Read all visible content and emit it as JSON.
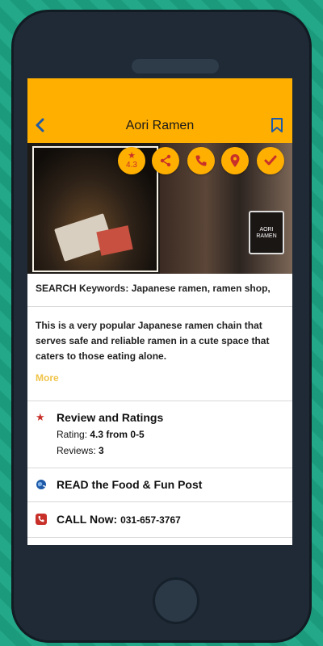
{
  "app": {
    "title": "Aori Ramen"
  },
  "hero": {
    "rating": "4.3",
    "sign_text": "AORI RAMEN",
    "actions": [
      "rating-icon",
      "share-icon",
      "phone-icon",
      "location-pin-icon",
      "check-icon"
    ]
  },
  "keywords": {
    "text": "SEARCH Keywords: Japanese ramen, ramen shop,"
  },
  "description": {
    "text": "This is a very popular Japanese ramen chain that serves safe and reliable ramen in a cute space that caters to those eating alone.",
    "more_label": "More"
  },
  "reviews": {
    "title": "Review and Ratings",
    "rating_label": "Rating:",
    "rating_value": "4.3 from 0-5",
    "reviews_label": "Reviews:",
    "reviews_value": "3"
  },
  "food_post": {
    "label": "READ the Food & Fun Post"
  },
  "call": {
    "label": "CALL Now:",
    "number": "031-657-3767"
  },
  "colors": {
    "header": "#ffaf00",
    "accent_red": "#c8302a",
    "link_blue": "#1e5aa8",
    "more_gold": "#f0c44a",
    "background_teal": "#23a889"
  }
}
